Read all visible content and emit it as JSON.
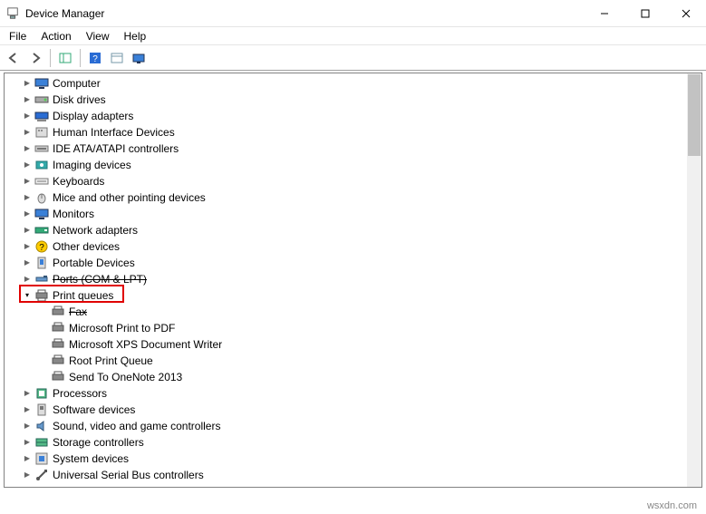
{
  "window": {
    "title": "Device Manager"
  },
  "menu": {
    "file": "File",
    "action": "Action",
    "view": "View",
    "help": "Help"
  },
  "tree": {
    "computer": "Computer",
    "disk_drives": "Disk drives",
    "display_adapters": "Display adapters",
    "hid": "Human Interface Devices",
    "ide": "IDE ATA/ATAPI controllers",
    "imaging": "Imaging devices",
    "keyboards": "Keyboards",
    "mice": "Mice and other pointing devices",
    "monitors": "Monitors",
    "network": "Network adapters",
    "other": "Other devices",
    "portable": "Portable Devices",
    "ports": "Ports (COM & LPT)",
    "print_queues": "Print queues",
    "pq_fax": "Fax",
    "pq_ms_pdf": "Microsoft Print to PDF",
    "pq_ms_xps": "Microsoft XPS Document Writer",
    "pq_root": "Root Print Queue",
    "pq_onenote": "Send To OneNote 2013",
    "processors": "Processors",
    "software": "Software devices",
    "sound": "Sound, video and game controllers",
    "storage": "Storage controllers",
    "system": "System devices",
    "usb": "Universal Serial Bus controllers"
  },
  "watermark": "wsxdn.com"
}
